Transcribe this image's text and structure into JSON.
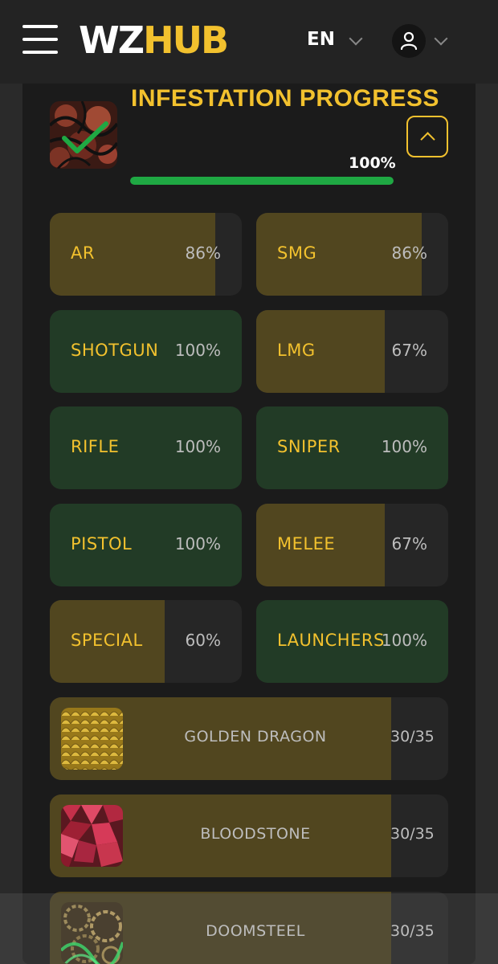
{
  "header": {
    "logo_part1": "WZ",
    "logo_part2": "HUB",
    "language": "EN",
    "menu_icon": "hamburger-menu-icon",
    "user_icon": "user-icon"
  },
  "progress": {
    "title": "INFESTATION PROGRESS",
    "overall_percent": "100%",
    "overall_value": 1.0,
    "completed_icon": "checkmark-icon"
  },
  "categories": [
    {
      "label": "AR",
      "percent": "86%",
      "value": 0.86
    },
    {
      "label": "SMG",
      "percent": "86%",
      "value": 0.86
    },
    {
      "label": "SHOTGUN",
      "percent": "100%",
      "value": 1.0
    },
    {
      "label": "LMG",
      "percent": "67%",
      "value": 0.67
    },
    {
      "label": "RIFLE",
      "percent": "100%",
      "value": 1.0
    },
    {
      "label": "SNIPER",
      "percent": "100%",
      "value": 1.0
    },
    {
      "label": "PISTOL",
      "percent": "100%",
      "value": 1.0
    },
    {
      "label": "MELEE",
      "percent": "67%",
      "value": 0.67
    },
    {
      "label": "SPECIAL",
      "percent": "60%",
      "value": 0.6
    },
    {
      "label": "LAUNCHERS",
      "percent": "100%",
      "value": 1.0
    }
  ],
  "camos": [
    {
      "name": "GOLDEN DRAGON",
      "count": "30/35",
      "value": 0.857
    },
    {
      "name": "BLOODSTONE",
      "count": "30/35",
      "value": 0.857
    },
    {
      "name": "DOOMSTEEL",
      "count": "30/35",
      "value": 0.857
    }
  ],
  "colors": {
    "accent": "#f2c12e",
    "complete_bg": "#223b26",
    "partial_fill": "#51461f",
    "progress_green": "#1fa843"
  }
}
